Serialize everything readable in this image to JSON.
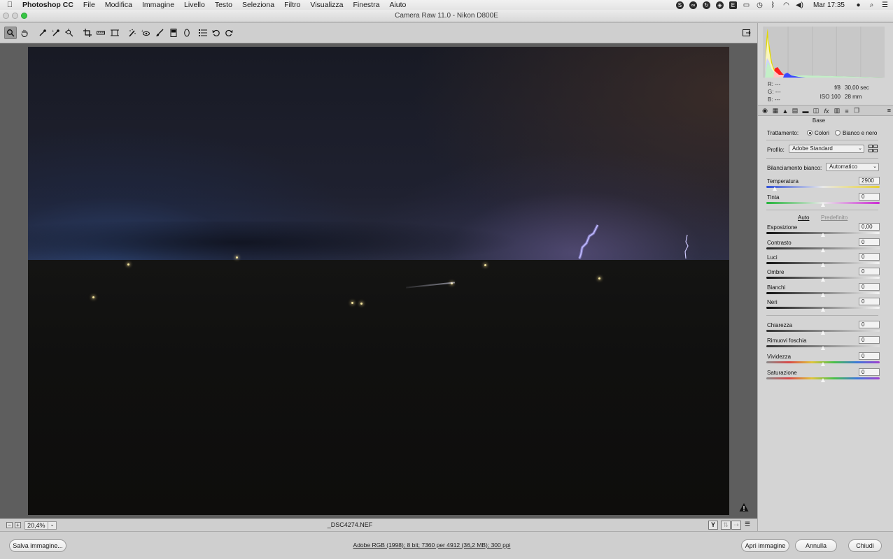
{
  "menubar": {
    "app_name": "Photoshop CC",
    "items": [
      "File",
      "Modifica",
      "Immagine",
      "Livello",
      "Testo",
      "Seleziona",
      "Filtro",
      "Visualizza",
      "Finestra",
      "Aiuto"
    ],
    "clock": "Mar 17:35"
  },
  "window": {
    "title": "Camera Raw 11.0  -  Nikon D800E"
  },
  "toolbar": {
    "tools": [
      "zoom-tool",
      "hand-tool",
      "white-balance-tool",
      "color-sampler-tool",
      "targeted-adjustment-tool",
      "crop-tool",
      "straighten-tool",
      "transform-tool",
      "spot-removal-tool",
      "red-eye-tool",
      "adjustment-brush",
      "graduated-filter",
      "radial-filter",
      "preferences",
      "rotate-left",
      "rotate-right"
    ],
    "active_tool": "zoom-tool"
  },
  "preview": {
    "zoom_value": "20,4%",
    "filename": "_DSC4274.NEF"
  },
  "info": {
    "r_label": "R:",
    "g_label": "G:",
    "b_label": "B:",
    "r_value": "---",
    "g_value": "---",
    "b_value": "---",
    "aperture": "f/8",
    "shutter": "30,00 sec",
    "iso": "ISO 100",
    "focal": "28 mm"
  },
  "panel": {
    "section": "Base",
    "treatment_label": "Trattamento:",
    "treatment_color": "Colori",
    "treatment_bw": "Bianco e nero",
    "profile_label": "Profilo:",
    "profile_value": "Adobe Standard",
    "wb_label": "Bilanciamento bianco:",
    "wb_value": "Automatico",
    "auto_label": "Auto",
    "default_label": "Predefinito",
    "sliders": [
      {
        "name": "Temperatura",
        "value": "2900",
        "position": 0.08
      },
      {
        "name": "Tinta",
        "value": "0",
        "position": 0.5
      },
      {
        "name": "Esposizione",
        "value": "0,00",
        "position": 0.5
      },
      {
        "name": "Contrasto",
        "value": "0",
        "position": 0.5
      },
      {
        "name": "Luci",
        "value": "0",
        "position": 0.5
      },
      {
        "name": "Ombre",
        "value": "0",
        "position": 0.5
      },
      {
        "name": "Bianchi",
        "value": "0",
        "position": 0.5
      },
      {
        "name": "Neri",
        "value": "0",
        "position": 0.5
      },
      {
        "name": "Chiarezza",
        "value": "0",
        "position": 0.5
      },
      {
        "name": "Rimuovi foschia",
        "value": "0",
        "position": 0.5
      },
      {
        "name": "Vividezza",
        "value": "0",
        "position": 0.5
      },
      {
        "name": "Saturazione",
        "value": "0",
        "position": 0.5
      }
    ]
  },
  "bottom": {
    "save_label": "Salva immagine...",
    "workflow": "Adobe RGB (1998); 8 bit; 7360 per 4912 (36,2 MB); 300 ppi",
    "open_label": "Apri immagine",
    "cancel_label": "Annulla",
    "close_label": "Chiudi"
  }
}
